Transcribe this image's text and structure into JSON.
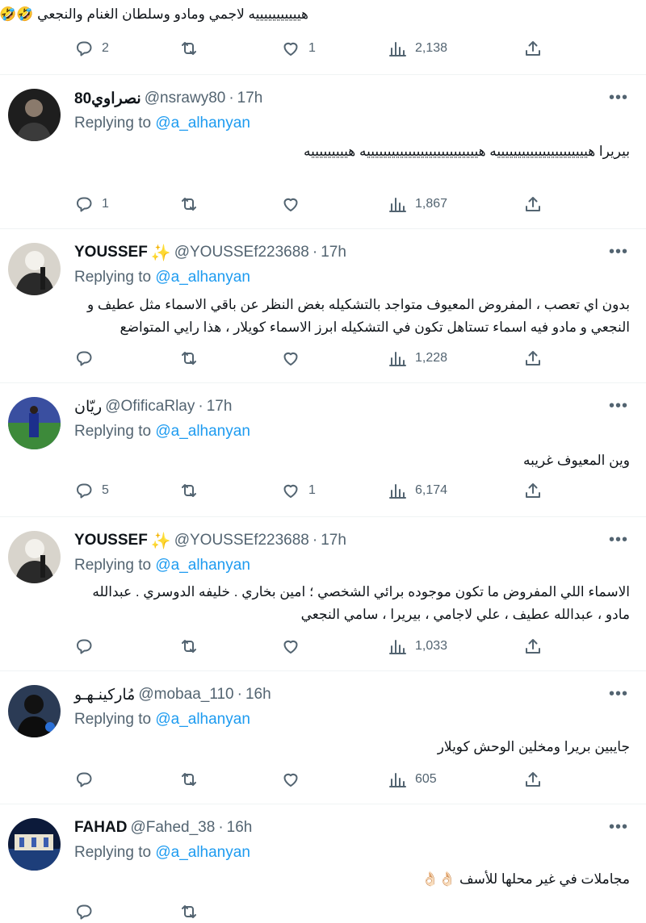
{
  "top_fragment": {
    "text": "هيييييييييييه لاجمي ومادو وسلطان الغنام والنجعي 🤣🤣",
    "replies": "2",
    "retweets": "",
    "likes": "1",
    "views": "2,138"
  },
  "replying_label": "Replying to",
  "tweets": [
    {
      "name": "نصراوي80",
      "handle": "@nsrawy80",
      "time": "17h",
      "sparkle": "",
      "reply_to": "@a_alhanyan",
      "text": "بيريرا هييييييييييييييييييييييه هيييييييييييييييييييييييييييه هيييييييييه",
      "replies": "1",
      "retweets": "",
      "likes": "",
      "views": "1,867"
    },
    {
      "name": "YOUSSEF",
      "handle": "@YOUSSEf223688",
      "time": "17h",
      "sparkle": "✨",
      "reply_to": "@a_alhanyan",
      "text": "بدون اي تعصب ، المفروض المعيوف متواجد بالتشكيله بغض النظر عن باقي الاسماء مثل عطيف و النجعي و مادو فيه اسماء تستاهل تكون في التشكيله ابرز الاسماء كويلار ، هذا رايي المتواضع",
      "replies": "",
      "retweets": "",
      "likes": "",
      "views": "1,228"
    },
    {
      "name": "ريّان",
      "handle": "@OfificaRlay",
      "time": "17h",
      "sparkle": "",
      "reply_to": "@a_alhanyan",
      "text": "وين المعيوف غريبه",
      "replies": "5",
      "retweets": "",
      "likes": "1",
      "views": "6,174"
    },
    {
      "name": "YOUSSEF",
      "handle": "@YOUSSEf223688",
      "time": "17h",
      "sparkle": "✨",
      "reply_to": "@a_alhanyan",
      "text": "الاسماء اللي المفروض ما تكون موجوده برائي الشخصي ؛ امين بخاري . خليفه الدوسري . عبدالله مادو ، عبدالله عطيف ، علي لاجامي ، بيريرا ، سامي النجعي",
      "replies": "",
      "retweets": "",
      "likes": "",
      "views": "1,033"
    },
    {
      "name": "مُاركينـهـو",
      "handle": "@mobaa_110",
      "time": "16h",
      "sparkle": "",
      "reply_to": "@a_alhanyan",
      "text": "جايبين بريرا ومخلين الوحش كويلار",
      "replies": "",
      "retweets": "",
      "likes": "",
      "views": "605"
    },
    {
      "name": "FAHAD",
      "handle": "@Fahed_38",
      "time": "16h",
      "sparkle": "",
      "reply_to": "@a_alhanyan",
      "text": "مجاملات في غير محلها للأسف 👌🏻👌🏻",
      "replies": "",
      "retweets": "",
      "likes": "",
      "views": ""
    }
  ]
}
